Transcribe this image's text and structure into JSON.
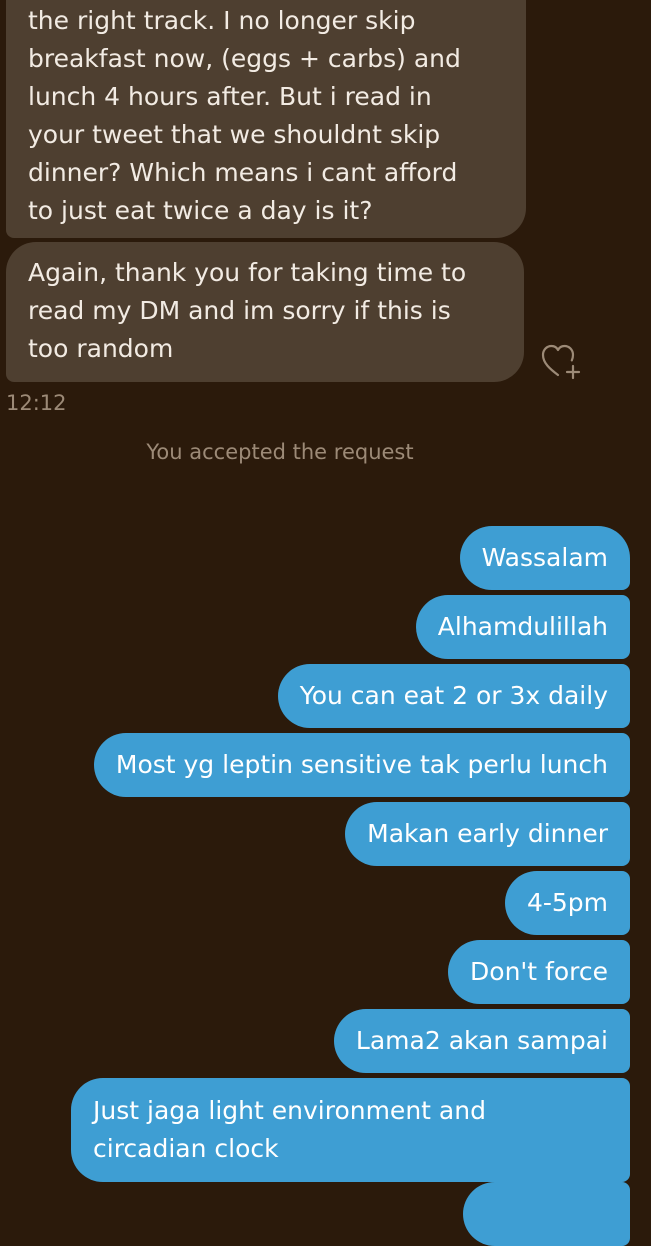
{
  "incoming": [
    {
      "lines": [
        "the right track. I no longer skip",
        "breakfast now, (eggs + carbs) and",
        "lunch 4 hours after. But i read in",
        "your tweet that we shouldnt skip",
        "dinner? Which means i cant afford",
        "to just eat twice a day is it?"
      ]
    },
    {
      "lines": [
        "Again, thank you for taking time to",
        "read my DM and im sorry if this is",
        "too random"
      ]
    }
  ],
  "timestamp": "12:12",
  "system_note": "You accepted the request",
  "outgoing": [
    {
      "text": "Wassalam"
    },
    {
      "text": "Alhamdulillah"
    },
    {
      "text": "You can eat 2 or 3x daily"
    },
    {
      "text": "Most yg leptin sensitive tak perlu lunch"
    },
    {
      "text": "Makan early dinner"
    },
    {
      "text": "4-5pm"
    },
    {
      "text": "Don't force"
    },
    {
      "text": "Lama2 akan sampai"
    },
    {
      "lines": [
        "Just jaga light environment and",
        "circadian clock"
      ]
    }
  ],
  "icons": {
    "react": "heart-plus-icon"
  },
  "colors": {
    "background": "#2b1a0b",
    "incoming_bubble": "#4e3f30",
    "outgoing_bubble": "#3e9ed3",
    "muted_text": "#9c8a77"
  }
}
